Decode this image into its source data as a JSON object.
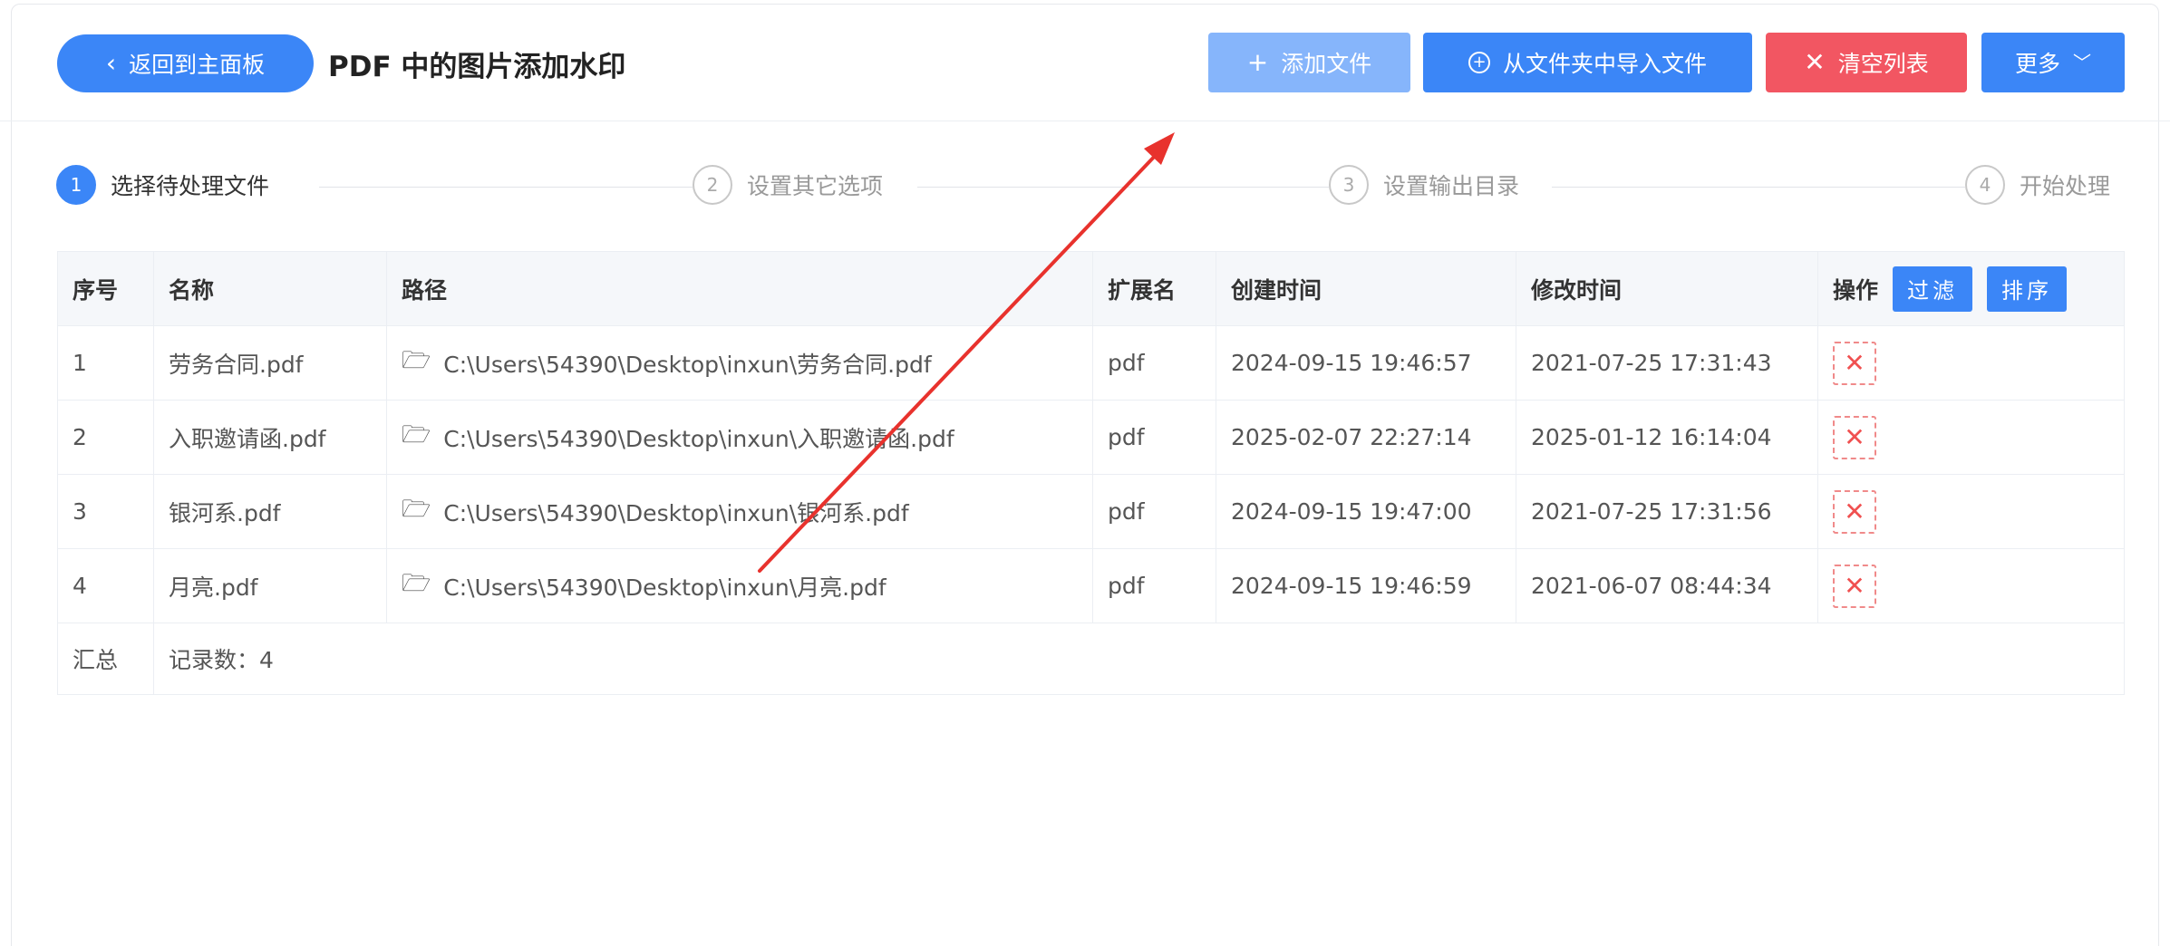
{
  "header": {
    "back_label": "返回到主面板",
    "title": "PDF 中的图片添加水印",
    "add_file_label": "添加文件",
    "import_folder_label": "从文件夹中导入文件",
    "clear_list_label": "清空列表",
    "more_label": "更多"
  },
  "steps": [
    {
      "num": "1",
      "label": "选择待处理文件"
    },
    {
      "num": "2",
      "label": "设置其它选项"
    },
    {
      "num": "3",
      "label": "设置输出目录"
    },
    {
      "num": "4",
      "label": "开始处理"
    }
  ],
  "table": {
    "columns": {
      "idx": "序号",
      "name": "名称",
      "path": "路径",
      "ext": "扩展名",
      "ctime": "创建时间",
      "mtime": "修改时间",
      "op": "操作"
    },
    "filter_label": "过滤",
    "sort_label": "排序",
    "rows": [
      {
        "idx": "1",
        "name": "劳务合同.pdf",
        "path": "C:\\Users\\54390\\Desktop\\inxun\\劳务合同.pdf",
        "ext": "pdf",
        "ctime": "2024-09-15 19:46:57",
        "mtime": "2021-07-25 17:31:43"
      },
      {
        "idx": "2",
        "name": "入职邀请函.pdf",
        "path": "C:\\Users\\54390\\Desktop\\inxun\\入职邀请函.pdf",
        "ext": "pdf",
        "ctime": "2025-02-07 22:27:14",
        "mtime": "2025-01-12 16:14:04"
      },
      {
        "idx": "3",
        "name": "银河系.pdf",
        "path": "C:\\Users\\54390\\Desktop\\inxun\\银河系.pdf",
        "ext": "pdf",
        "ctime": "2024-09-15 19:47:00",
        "mtime": "2021-07-25 17:31:56"
      },
      {
        "idx": "4",
        "name": "月亮.pdf",
        "path": "C:\\Users\\54390\\Desktop\\inxun\\月亮.pdf",
        "ext": "pdf",
        "ctime": "2024-09-15 19:46:59",
        "mtime": "2021-06-07 08:44:34"
      }
    ],
    "summary_label": "汇总",
    "summary_value": "记录数：4"
  },
  "icons": {
    "back": "chevron-left-icon",
    "add": "plus-icon",
    "import": "circle-plus-icon",
    "clear": "close-icon",
    "more": "chevron-down-icon",
    "path": "folder-open-icon",
    "delete": "delete-x-icon"
  },
  "colors": {
    "primary": "#3b86f7",
    "primary_light": "#86b5fb",
    "danger": "#f25662",
    "annotation_arrow": "#e8322d"
  }
}
